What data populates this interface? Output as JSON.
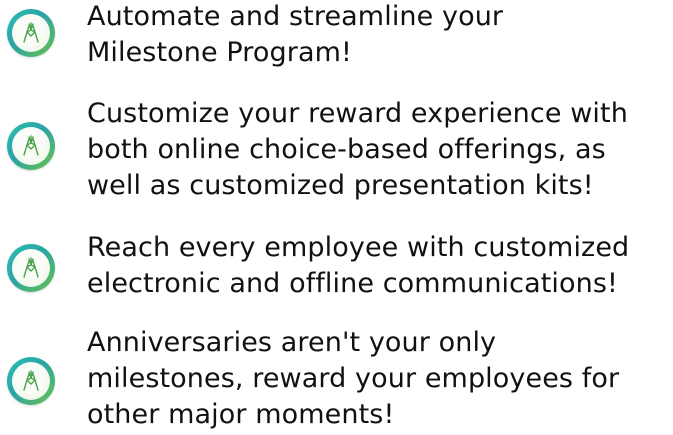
{
  "items": [
    {
      "icon": "high-five-hands-icon",
      "text": "Automate and streamline your\nMilestone Program!"
    },
    {
      "icon": "high-five-hands-icon",
      "text": "Customize your reward experience with\nboth online choice-based offerings, as\nwell as customized presentation kits!"
    },
    {
      "icon": "high-five-hands-icon",
      "text": "Reach every employee with customized\nelectronic and offline communications!"
    },
    {
      "icon": "high-five-hands-icon",
      "text": "Anniversaries aren't your only\nmilestones, reward your employees for\nother major moments!"
    }
  ],
  "colors": {
    "badge_teal": "#2aa3a6",
    "badge_green": "#6cc24a",
    "icon_stroke": "#4aa44a",
    "text": "#111111"
  }
}
